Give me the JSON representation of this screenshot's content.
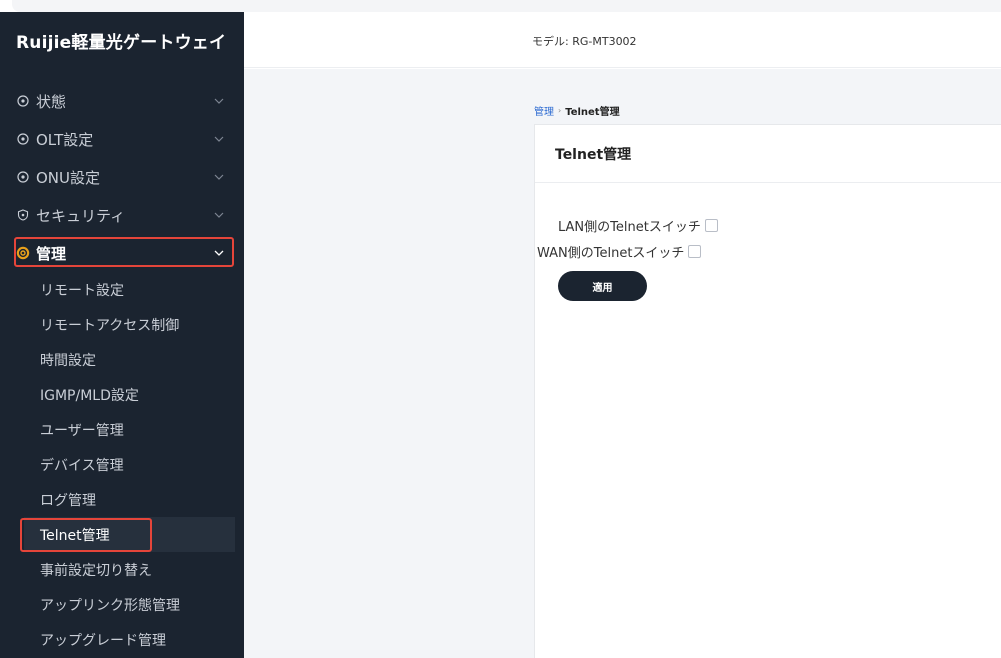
{
  "app": {
    "title": "Ruijie軽量光ゲートウェイ"
  },
  "header": {
    "model_label": "モデル:",
    "model_value": "RG-MT3002"
  },
  "sidebar": {
    "items": [
      {
        "label": "状態",
        "icon": "circle-dot-icon",
        "expanded": false
      },
      {
        "label": "OLT設定",
        "icon": "circle-dot-icon",
        "expanded": false
      },
      {
        "label": "ONU設定",
        "icon": "circle-dot-icon",
        "expanded": false
      },
      {
        "label": "セキュリティ",
        "icon": "shield-icon",
        "expanded": false
      },
      {
        "label": "管理",
        "icon": "gear-icon",
        "expanded": true,
        "active": true
      }
    ],
    "sub_items": [
      {
        "label": "リモート設定"
      },
      {
        "label": "リモートアクセス制御"
      },
      {
        "label": "時間設定"
      },
      {
        "label": "IGMP/MLD設定"
      },
      {
        "label": "ユーザー管理"
      },
      {
        "label": "デバイス管理"
      },
      {
        "label": "ログ管理"
      },
      {
        "label": "Telnet管理",
        "active": true
      },
      {
        "label": "事前設定切り替え"
      },
      {
        "label": "アップリンク形態管理"
      },
      {
        "label": "アップグレード管理"
      }
    ]
  },
  "breadcrumb": {
    "parent": "管理",
    "separator": "›",
    "current": "Telnet管理"
  },
  "card": {
    "title": "Telnet管理",
    "options": [
      {
        "label": "LAN側のTelnetスイッチ",
        "checked": false
      },
      {
        "label": "WAN側のTelnetスイッチ",
        "checked": false
      }
    ],
    "apply_label": "適用"
  },
  "colors": {
    "sidebar_bg": "#1b2430",
    "highlight": "#e5453a",
    "accent_gear": "#e9a11b",
    "link": "#2d6bd1"
  }
}
